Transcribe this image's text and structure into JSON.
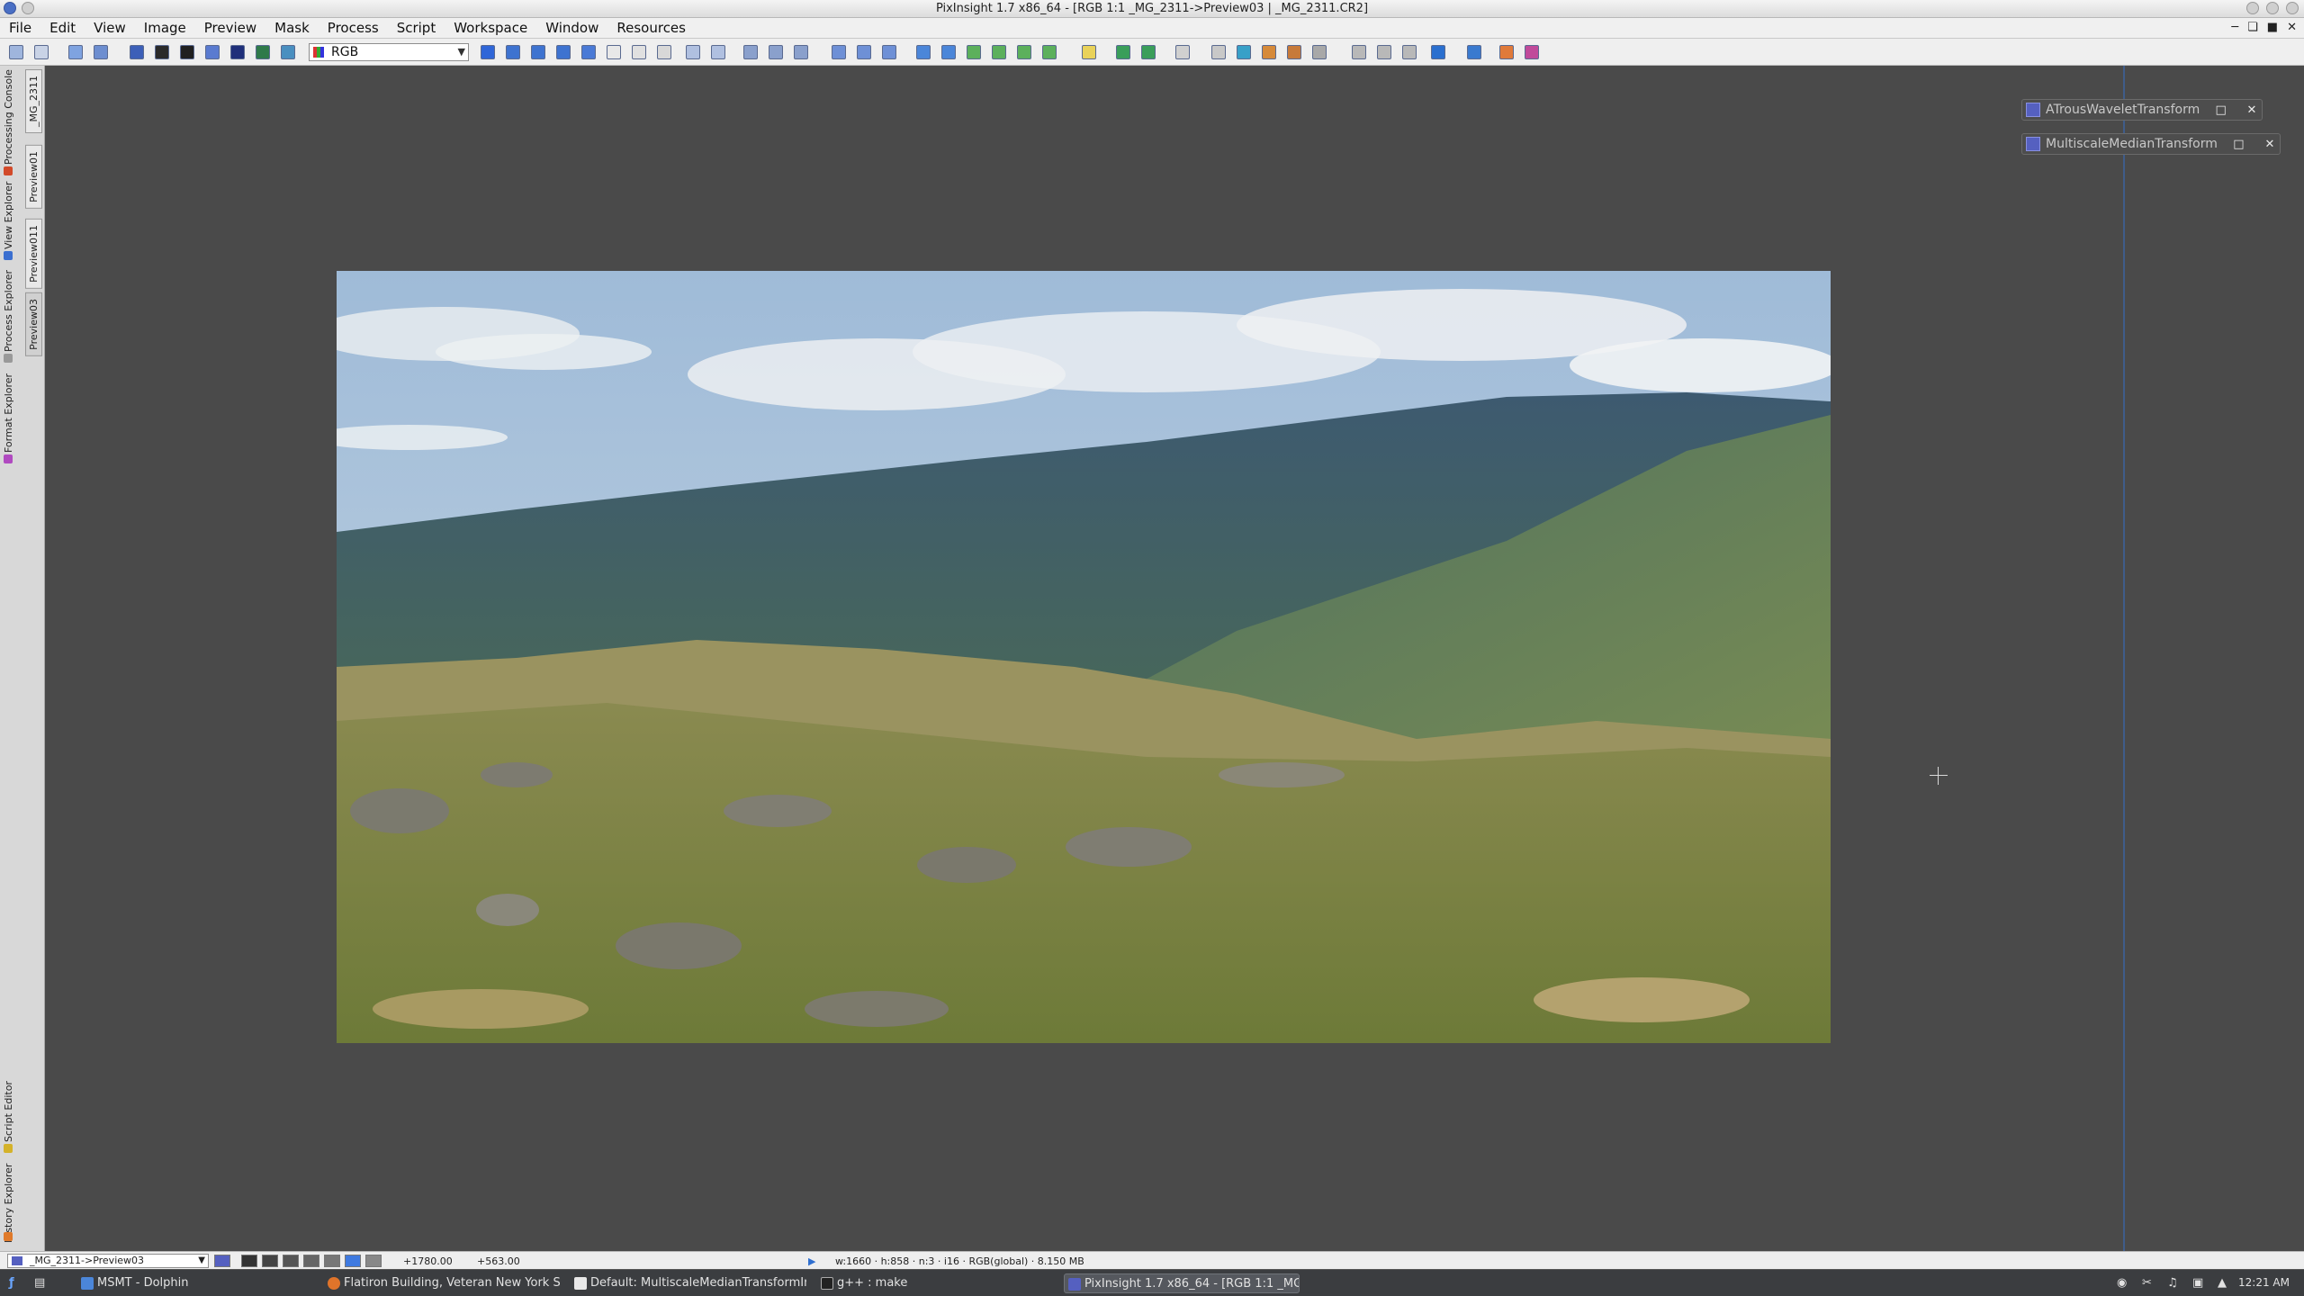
{
  "window": {
    "title": "PixInsight 1.7 x86_64 - [RGB 1:1 _MG_2311->Preview03 | _MG_2311.CR2]"
  },
  "menu": [
    "File",
    "Edit",
    "View",
    "Image",
    "Preview",
    "Mask",
    "Process",
    "Script",
    "Workspace",
    "Window",
    "Resources"
  ],
  "toolbar": {
    "color_mode": "RGB"
  },
  "left_tabs": [
    "Processing Console",
    "View Explorer",
    "Process Explorer",
    "Format Explorer",
    "Script Editor",
    "History Explorer"
  ],
  "preview_tabs": [
    "_MG_2311",
    "Preview01",
    "Preview011",
    "Preview03"
  ],
  "iconic_processes": [
    {
      "label": "ATrousWaveletTransform"
    },
    {
      "label": "MultiscaleMedianTransform"
    }
  ],
  "statusbar": {
    "view": "_MG_2311->Preview03",
    "x": "+1780.00",
    "y": "+563.00",
    "info": "w:1660 · h:858 · n:3 · i16 · RGB(global) · 8.150 MB"
  },
  "taskbar": {
    "tasks": [
      {
        "label": "MSMT - Dolphin",
        "active": false
      },
      {
        "label": "Flatiron Building, Veteran New York Sky",
        "active": false
      },
      {
        "label": "Default: MultiscaleMedianTransformInst",
        "active": false
      },
      {
        "label": "g++ : make",
        "active": false
      },
      {
        "label": "PixInsight 1.7 x86_64 - [RGB 1:1 _MG_",
        "active": true
      }
    ],
    "clock": "12:21 AM"
  },
  "colors": {
    "workspace": "#4a4a4a",
    "accent": "#3f5c8a",
    "taskbar": "#3b3d40"
  }
}
